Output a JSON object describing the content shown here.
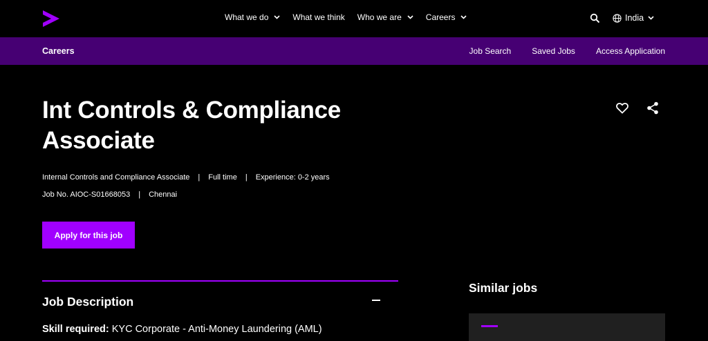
{
  "nav": {
    "menu": [
      {
        "label": "What we do",
        "has_dropdown": true
      },
      {
        "label": "What we think",
        "has_dropdown": false
      },
      {
        "label": "Who we are",
        "has_dropdown": true
      },
      {
        "label": "Careers",
        "has_dropdown": true
      }
    ],
    "locale": "India"
  },
  "subnav": {
    "title": "Careers",
    "links": [
      "Job Search",
      "Saved Jobs",
      "Access Application"
    ]
  },
  "job": {
    "title": "Int Controls & Compliance Associate",
    "meta_line1": [
      "Internal Controls and Compliance Associate",
      "Full time",
      "Experience: 0-2 years"
    ],
    "meta_line2": [
      "Job No. AIOC-S01668053",
      "Chennai"
    ],
    "separator": "|",
    "apply_label": "Apply for this job"
  },
  "description": {
    "heading": "Job Description",
    "skill_label": "Skill required:",
    "skill_value": "KYC Corporate - Anti-Money Laundering (AML)"
  },
  "similar": {
    "heading": "Similar jobs"
  },
  "colors": {
    "accent": "#a100ff",
    "subnav_bg": "#460073",
    "background": "#000000"
  },
  "icons": [
    "accenture-logo-icon",
    "chevron-down-icon",
    "search-icon",
    "globe-icon",
    "heart-icon",
    "share-icon",
    "minus-icon"
  ]
}
